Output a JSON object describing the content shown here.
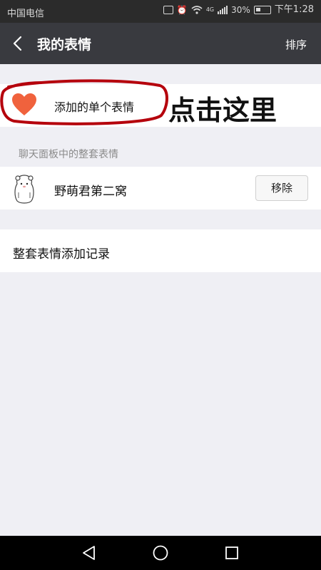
{
  "status_bar": {
    "carrier": "中国电信",
    "network": "4G",
    "battery": "30%",
    "time": "下午1:28"
  },
  "app_bar": {
    "title": "我的表情",
    "sort_label": "排序"
  },
  "single_emoji": {
    "label": "添加的单个表情",
    "icon": "heart-icon",
    "heart_color": "#f0623d"
  },
  "annotation": {
    "text": "点击这里",
    "circle_color": "#b5000c"
  },
  "section": {
    "header": "聊天面板中的整套表情"
  },
  "sticker_packs": [
    {
      "name": "野萌君第二窝",
      "button_label": "移除",
      "icon": "bear-sticker-icon"
    }
  ],
  "history": {
    "label": "整套表情添加记录"
  },
  "nav_bar": {
    "icons": [
      "back-triangle-icon",
      "home-circle-icon",
      "recents-square-icon"
    ]
  }
}
